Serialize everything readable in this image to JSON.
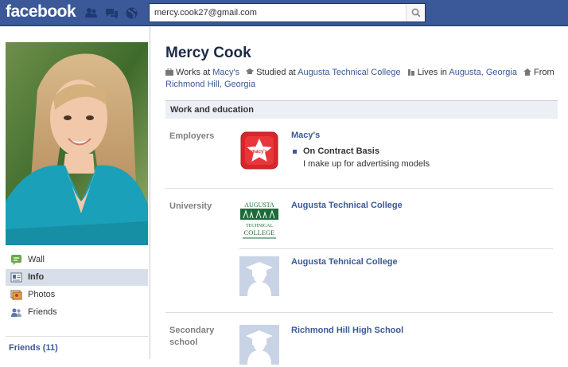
{
  "topbar": {
    "logo": "facebook",
    "icons": [
      "friend-requests-icon",
      "messages-icon",
      "notifications-globe-icon"
    ],
    "search_value": "mercy.cook27@gmail.com",
    "search_placeholder": "Search",
    "brand_color": "#3b5998"
  },
  "sidebar": {
    "nav": [
      {
        "label": "Wall",
        "icon": "wall-icon"
      },
      {
        "label": "Info",
        "icon": "info-icon",
        "active": true
      },
      {
        "label": "Photos",
        "icon": "photos-icon"
      },
      {
        "label": "Friends",
        "icon": "friends-icon"
      }
    ],
    "friends_link": "Friends (11)"
  },
  "profile": {
    "name": "Mercy Cook",
    "works_at_prefix": "Works at",
    "works_at": "Macy's",
    "studied_prefix": "Studied at",
    "studied_at": "Augusta Technical College",
    "lives_prefix": "Lives in",
    "lives_in": "Augusta, Georgia",
    "from_prefix": "From",
    "from": "Richmond Hill, Georgia"
  },
  "work_education": {
    "header": "Work and education",
    "employers_label": "Employers",
    "employer": {
      "name": "Macy's",
      "position": "On Contract Basis",
      "description": "I make up for advertising models"
    },
    "university_label": "University",
    "universities": [
      "Augusta Technical College",
      "Augusta Tehnical College"
    ],
    "augusta_logo_lines": [
      "AUGUSTA",
      "TECHNICAL",
      "COLLEGE"
    ],
    "secondary_label_1": "Secondary",
    "secondary_label_2": "school",
    "secondary_school": "Richmond Hill High School"
  }
}
